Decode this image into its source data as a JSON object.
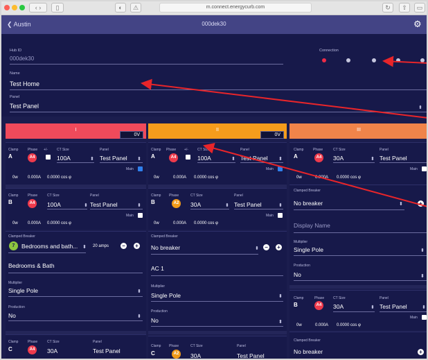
{
  "browser": {
    "url": "m.connect.energycurb.com",
    "colors": {
      "close": "#fc5f57",
      "min": "#fdbc2e",
      "max": "#28c840"
    }
  },
  "nav": {
    "back_label": "Austin",
    "title": "000dek30"
  },
  "hub": {
    "id_label": "Hub ID",
    "id_value": "000dek30",
    "connection_label": "Connection",
    "name_label": "Name",
    "name_value": "Test Home",
    "panel_label": "Panel",
    "panel_value": "Test Panel"
  },
  "columns": [
    {
      "number": "I",
      "voltage": "0V",
      "color": "#f04a5b"
    },
    {
      "number": "II",
      "voltage": "0V",
      "color": "#f59c1c"
    },
    {
      "number": "III",
      "voltage": "",
      "color": "#f0844a"
    }
  ],
  "labels": {
    "clamp": "Clamp",
    "phase": "Phase",
    "plus_minus": "+/-",
    "ct_size": "CT Size",
    "panel": "Panel",
    "main": "Main",
    "clamped_breaker": "Clamped Breaker",
    "multiplier": "Multiplier",
    "production": "Production",
    "display_name": "Display Name"
  },
  "col1": {
    "a": {
      "clamp": "A",
      "phase": "A4",
      "ct": "100A",
      "panel": "Test Panel",
      "v": "0w",
      "a": "0.000A",
      "pf": "0.0000 cos φ"
    },
    "b": {
      "clamp": "B",
      "phase": "A4",
      "ct": "100A",
      "panel": "Test Panel",
      "v": "0w",
      "a": "0.000A",
      "pf": "0.0000 cos φ"
    },
    "breaker_num": "7",
    "breaker_name": "Bedrooms and bath...",
    "breaker_amps": "20 amps",
    "display_name": "Bedrooms & Bath",
    "multiplier": "Single Pole",
    "production": "No",
    "c": {
      "clamp": "C",
      "phase": "A4",
      "ct": "30A",
      "panel": "Test Panel"
    }
  },
  "col2": {
    "a": {
      "clamp": "A",
      "phase": "A4",
      "ct": "100A",
      "panel": "Test Panel",
      "v": "0w",
      "a": "0.000A",
      "pf": "0.0000 cos φ"
    },
    "b": {
      "clamp": "B",
      "phase": "A2",
      "ct": "30A",
      "panel": "Test Panel",
      "v": "0w",
      "a": "0.000A",
      "pf": "0.0000 cos φ"
    },
    "breaker_name": "No breaker",
    "display_name": "AC 1",
    "multiplier": "Single Pole",
    "production": "No",
    "c": {
      "clamp": "C",
      "phase": "A2",
      "ct": "30A",
      "panel": "Test Panel"
    }
  },
  "col3": {
    "a": {
      "clamp": "A",
      "phase": "A4",
      "ct": "30A",
      "panel": "Test Panel",
      "v": "0w",
      "a": "0.000A",
      "pf": "0.0000 cos φ"
    },
    "breaker_name": "No breaker",
    "display_placeholder": "Display Name",
    "multiplier": "Single Pole",
    "production": "No",
    "b": {
      "clamp": "B",
      "phase": "A4",
      "ct": "30A",
      "panel": "Test Panel",
      "v": "0w",
      "a": "0.000A",
      "pf": "0.0000 cos φ"
    },
    "breaker_name_2": "No breaker"
  },
  "annotation_color": "#e8252a"
}
